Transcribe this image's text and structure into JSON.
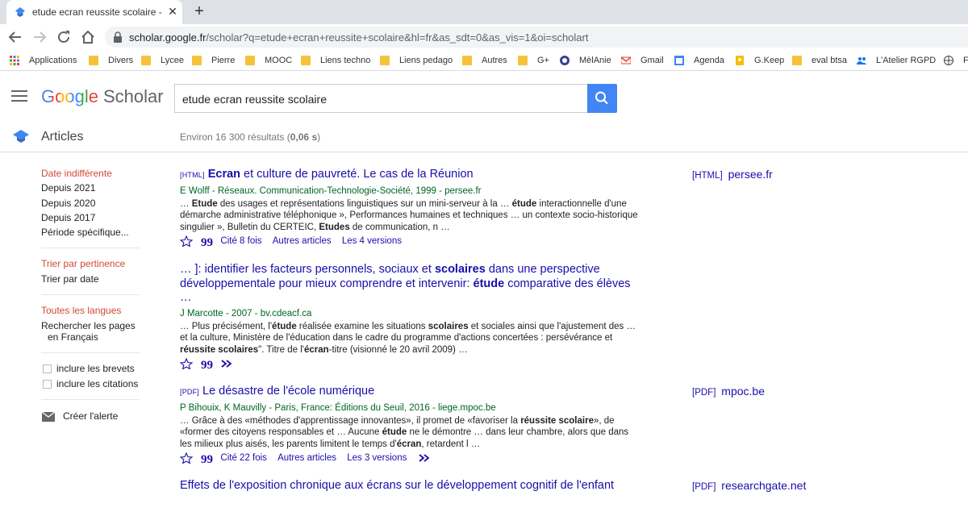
{
  "browser": {
    "tab_title": "etude ecran reussite scolaire - Go",
    "url_host": "scholar.google.fr",
    "url_path": "/scholar?q=etude+ecran+reussite+scolaire&hl=fr&as_sdt=0&as_vis=1&oi=scholart",
    "bookmarks": [
      {
        "label": "Applications",
        "icon": "apps-grid-icon"
      },
      {
        "label": "Divers",
        "icon": "folder-icon"
      },
      {
        "label": "Lycee",
        "icon": "folder-icon"
      },
      {
        "label": "Pierre",
        "icon": "folder-icon"
      },
      {
        "label": "MOOC",
        "icon": "folder-icon"
      },
      {
        "label": "Liens techno",
        "icon": "folder-icon"
      },
      {
        "label": "Liens pedago",
        "icon": "folder-icon"
      },
      {
        "label": "Autres",
        "icon": "folder-icon"
      },
      {
        "label": "G+",
        "icon": "folder-icon"
      },
      {
        "label": "MèlAnie",
        "icon": "melanie-icon"
      },
      {
        "label": "Gmail",
        "icon": "gmail-icon"
      },
      {
        "label": "Agenda",
        "icon": "calendar-icon"
      },
      {
        "label": "G.Keep",
        "icon": "keep-icon"
      },
      {
        "label": "eval btsa",
        "icon": "folder-icon"
      },
      {
        "label": "L'Atelier RGPD",
        "icon": "people-icon"
      },
      {
        "label": "Fr",
        "icon": "globe-icon"
      }
    ]
  },
  "header": {
    "logo_google": "Google",
    "logo_scholar": "Scholar",
    "search_value": "etude ecran reussite scolaire"
  },
  "subheader": {
    "articles": "Articles",
    "results_prefix": "Environ 16 300 résultats (",
    "results_time": "0,06 s",
    "results_suffix": ")"
  },
  "sidebar": {
    "date_active": "Date indifférente",
    "date_options": [
      "Depuis 2021",
      "Depuis 2020",
      "Depuis 2017",
      "Période spécifique..."
    ],
    "sort_active": "Trier par pertinence",
    "sort_other": "Trier par date",
    "lang_active": "Toutes les langues",
    "lang_other_1": "Rechercher les pages",
    "lang_other_2": "en Français",
    "check_patents": "inclure les brevets",
    "check_citations": "inclure les citations",
    "alert": "Créer l'alerte"
  },
  "results": [
    {
      "tag": "[HTML]",
      "title_bold": "Ecran",
      "title_rest": " et culture de pauvreté. Le cas de la Réunion",
      "authors": "E Wolff - Réseaux. Communication-Technologie-Société, 1999 - persee.fr",
      "snippet_1": "… ",
      "snippet_b1": "Etude",
      "snippet_2": " des usages et représentations linguistiques sur un mini-serveur à la … ",
      "snippet_b2": "étude",
      "snippet_3": " interactionnelle d'une démarche administrative téléphonique », Performances humaines et techniques … un contexte socio-historique singulier », Bulletin du CERTEIC, ",
      "snippet_b3": "Etudes",
      "snippet_4": " de communication, n …",
      "cited": "Cité 8 fois",
      "related": "Autres articles",
      "versions": "Les 4 versions",
      "side_tag": "[HTML]",
      "side_host": "persee.fr"
    },
    {
      "title_1": "… ]: identifier les facteurs personnels, sociaux et ",
      "title_b1": "scolaires",
      "title_2": " dans une perspective développementale pour mieux comprendre et intervenir: ",
      "title_b2": "étude",
      "title_3": " comparative des élèves …",
      "authors": "J Marcotte - 2007 - bv.cdeacf.ca",
      "snippet_1": "… Plus précisément, l'",
      "snippet_b1": "étude",
      "snippet_2": " réalisée examine les situations ",
      "snippet_b2": "scolaires",
      "snippet_3": " et sociales ainsi que l'ajustement des … et la culture, Ministère de l'éducation dans le cadre du programme d'actions concertées : persévérance et ",
      "snippet_b3": "réussite scolaires",
      "snippet_4": "\". Titre de l'",
      "snippet_b4": "écran",
      "snippet_5": "-titre (visionné le 20 avril 2009) …"
    },
    {
      "tag": "[PDF]",
      "title": "Le désastre de l'école numérique",
      "authors": "P Bihouix, K Mauvilly - Paris, France: Éditions du Seuil, 2016 - liege.mpoc.be",
      "snippet_1": "… Grâce à des «méthodes d'apprentissage innovantes», il promet de «favoriser la ",
      "snippet_b1": "réussite scolaire",
      "snippet_2": "», de «former des citoyens responsables et … Aucune ",
      "snippet_b2": "étude",
      "snippet_3": " ne le démontre … dans leur chambre, alors que dans les milieux plus aisés, les parents limitent le temps d'",
      "snippet_b3": "écran",
      "snippet_4": ", retardent l …",
      "cited": "Cité 22 fois",
      "related": "Autres articles",
      "versions": "Les 3 versions",
      "side_tag": "[PDF]",
      "side_host": "mpoc.be"
    },
    {
      "title": "Effets de l'exposition chronique aux écrans sur le développement cognitif de l'enfant",
      "side_tag": "[PDF]",
      "side_host": "researchgate.net"
    }
  ]
}
